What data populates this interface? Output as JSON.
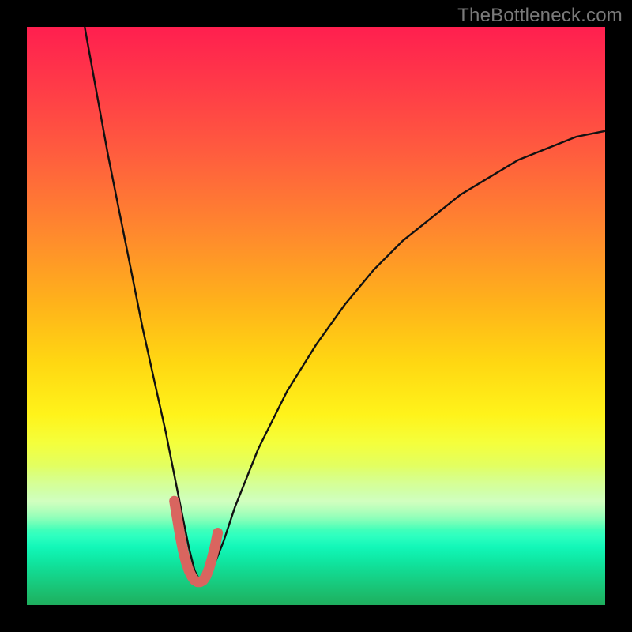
{
  "watermark": "TheBottleneck.com",
  "colors": {
    "frame": "#000000",
    "curve_main": "#111111",
    "curve_highlight": "#d9655f",
    "watermark_text": "#7a7a7a"
  },
  "chart_data": {
    "type": "line",
    "title": "",
    "xlabel": "",
    "ylabel": "",
    "xlim": [
      0,
      100
    ],
    "ylim": [
      0,
      100
    ],
    "grid": false,
    "legend": null,
    "series": [
      {
        "name": "bottleneck-curve",
        "color": "#111111",
        "x": [
          10,
          12,
          14,
          16,
          18,
          20,
          22,
          24,
          25,
          26,
          27,
          28,
          29,
          30,
          31,
          32,
          34,
          36,
          40,
          45,
          50,
          55,
          60,
          65,
          70,
          75,
          80,
          85,
          90,
          95,
          100
        ],
        "y": [
          100,
          89,
          78,
          68,
          58,
          48,
          39,
          30,
          25,
          20,
          15,
          10,
          6,
          4,
          4,
          6,
          11,
          17,
          27,
          37,
          45,
          52,
          58,
          63,
          67,
          71,
          74,
          77,
          79,
          81,
          82
        ]
      },
      {
        "name": "bottleneck-minimum-highlight",
        "color": "#d9655f",
        "x": [
          25.5,
          26,
          26.5,
          27,
          27.5,
          28,
          28.5,
          29,
          29.5,
          30,
          30.5,
          31,
          31.5,
          32,
          32.5,
          33
        ],
        "y": [
          18,
          15,
          12,
          9.5,
          7.5,
          6,
          5,
          4.3,
          4,
          4,
          4.3,
          5,
          6.3,
          8,
          10,
          12.5
        ]
      }
    ],
    "annotations": []
  }
}
